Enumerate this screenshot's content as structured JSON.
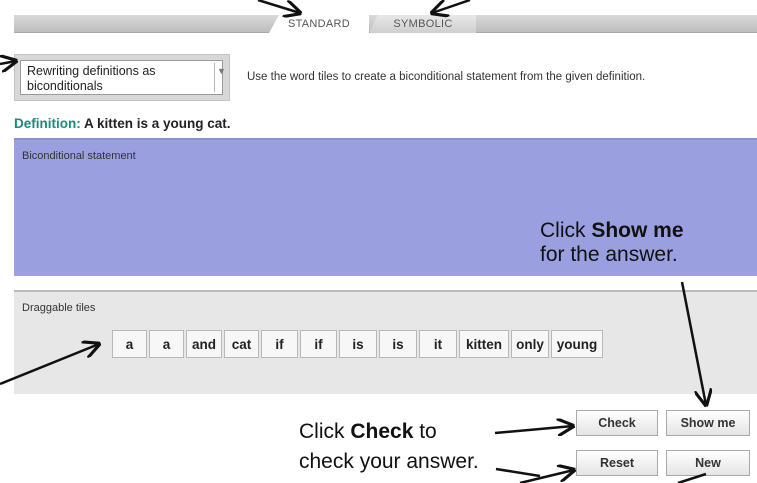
{
  "tabs": [
    {
      "label": "STANDARD",
      "active": true
    },
    {
      "label": "SYMBOLIC",
      "active": false
    }
  ],
  "topic_select": {
    "value": "Rewriting definitions as biconditionals"
  },
  "instruction": "Use the word tiles to create a biconditional statement from the given definition.",
  "definition": {
    "label": "Definition:",
    "text": "A kitten is a young cat."
  },
  "biconditional_area": {
    "label": "Biconditional statement"
  },
  "tiles_area": {
    "label": "Draggable tiles",
    "tiles": [
      "a",
      "a",
      "and",
      "cat",
      "if",
      "if",
      "is",
      "is",
      "it",
      "kitten",
      "only",
      "young"
    ]
  },
  "buttons": {
    "check": "Check",
    "show_me": "Show me",
    "reset": "Reset",
    "new": "New"
  },
  "callouts": {
    "show_me_line1_pre": "Click ",
    "show_me_line1_bold": "Show me",
    "show_me_line2": "for the answer.",
    "check_pre": "Click ",
    "check_bold": "Check",
    "check_post": " to",
    "check_line2": "check your answer."
  },
  "colors": {
    "definition_label": "#1a8a7a",
    "biconditional_bg": "#9a9fe0",
    "tiles_bg": "#e7e7e7"
  }
}
